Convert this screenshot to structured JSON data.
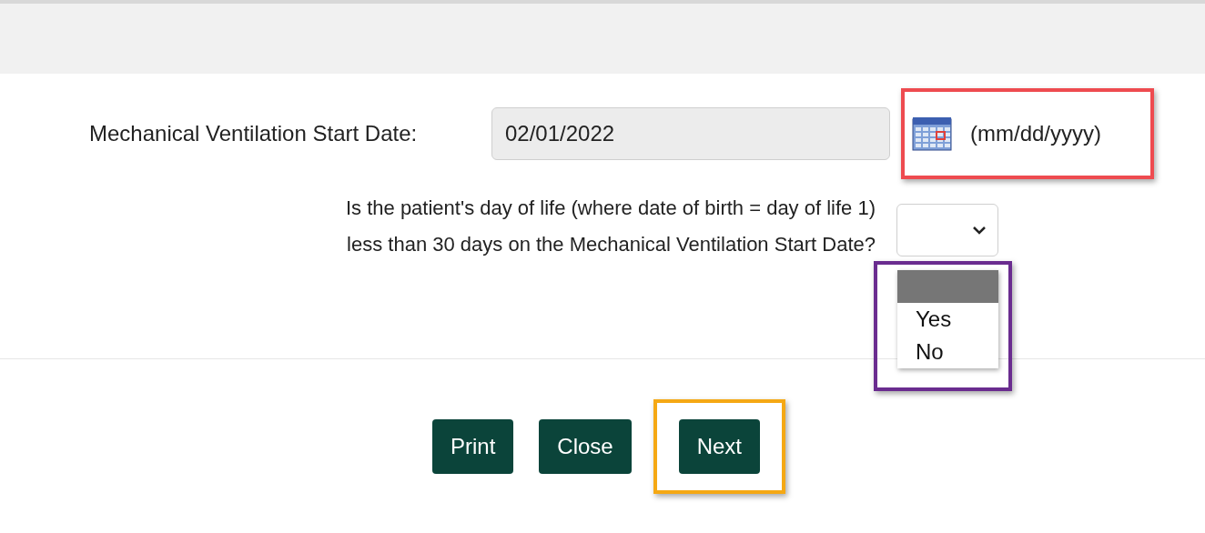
{
  "date_field": {
    "label": "Mechanical Ventilation Start Date:",
    "value": "02/01/2022",
    "format_hint": "(mm/dd/yyyy)",
    "highlight": {
      "color": "#ee4b50"
    }
  },
  "question": {
    "lines": [
      "Is the patient's day of life (where date of birth = day of life 1)",
      "less than 30 days on the Mechanical Ventilation Start Date?"
    ],
    "blank_option_highlighted": true,
    "options": [
      "Yes",
      "No"
    ],
    "highlight": {
      "color": "#6a2c8f"
    }
  },
  "buttons": [
    {
      "label": "Print"
    },
    {
      "label": "Close"
    },
    {
      "label": "Next",
      "highlight": {
        "color": "#f5a814"
      }
    }
  ]
}
